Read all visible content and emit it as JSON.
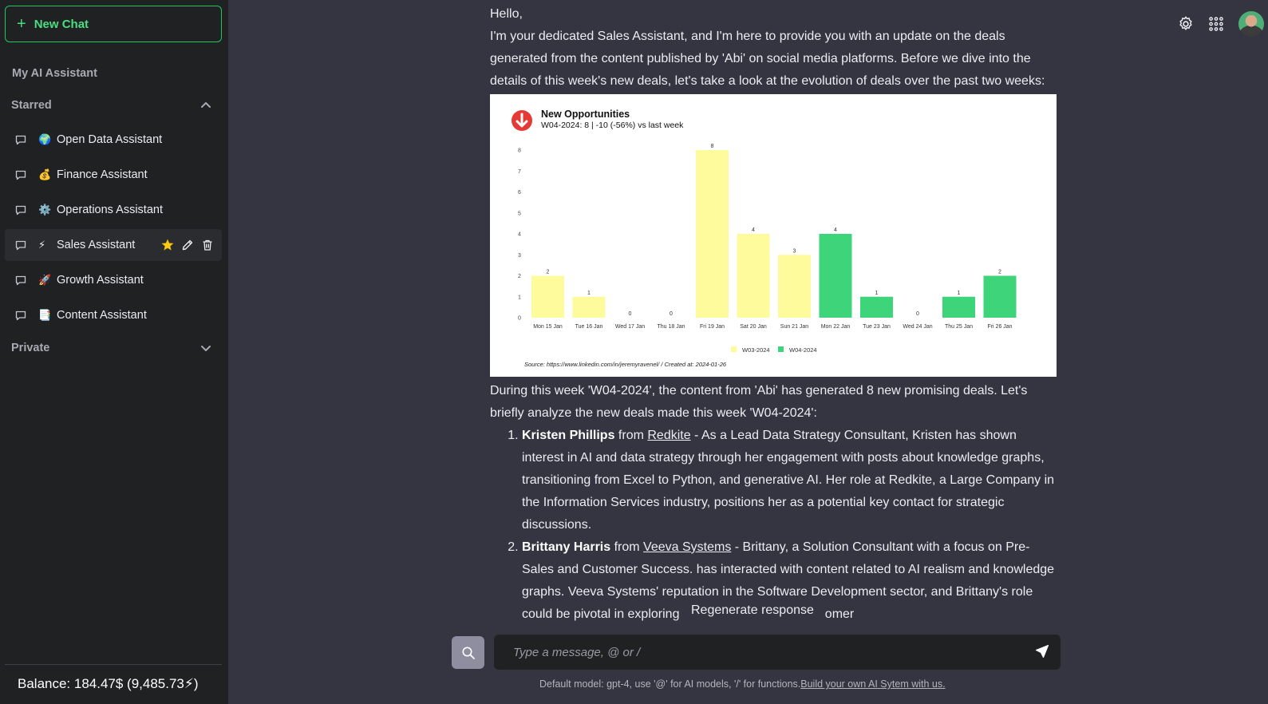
{
  "sidebar": {
    "new_chat": "New Chat",
    "my_assistant": "My AI Assistant",
    "starred": "Starred",
    "private": "Private",
    "items": [
      {
        "emoji": "🌍",
        "label": "Open Data Assistant"
      },
      {
        "emoji": "💰",
        "label": "Finance Assistant"
      },
      {
        "emoji": "⚙️",
        "label": "Operations Assistant"
      },
      {
        "emoji": "⚡",
        "label": "Sales Assistant"
      },
      {
        "emoji": "🚀",
        "label": "Growth Assistant"
      },
      {
        "emoji": "📑",
        "label": "Content Assistant"
      }
    ],
    "balance": "Balance: 184.47$ (9,485.73⚡)"
  },
  "message": {
    "greeting": "Hello,",
    "intro": "I'm your dedicated Sales Assistant, and I'm here to provide you with an update on the deals generated from the content published by 'Abi' on social media platforms. Before we dive into the details of this week's new deals, let's take a look at the evolution of deals over the past two weeks:",
    "summary": "During this week 'W04-2024', the content from 'Abi' has generated 8 new promising deals. Let's briefly analyze the new deals made this week 'W04-2024':",
    "deals": [
      {
        "name": "Kristen Phillips",
        "from": " from ",
        "company": "Redkite",
        "text": " - As a Lead Data Strategy Consultant, Kristen has shown interest in AI and data strategy through her engagement with posts about knowledge graphs, transitioning from Excel to Python, and generative AI. Her role at Redkite, a Large Company in the Information Services industry, positions her as a potential key contact for strategic discussions."
      },
      {
        "name": "Brittany Harris",
        "from": " from ",
        "company": "Veeva Systems",
        "text": " - Brittany, a Solution Consultant with a focus on Pre-Sales and Customer Success. has interacted with content related to AI realism and knowledge graphs. Veeva Systems' reputation in the Software Development sector, and Brittany's role could be pivotal in exploring how AI can enhance customer"
      }
    ]
  },
  "chart_data": {
    "type": "bar",
    "title": "New Opportunities",
    "subtitle": "W04-2024: 8 | -10 (-56%) vs last week",
    "categories": [
      "Mon 15 Jan",
      "Tue 16 Jan",
      "Wed 17 Jan",
      "Thu 18 Jan",
      "Fri 19 Jan",
      "Sat 20 Jan",
      "Sun 21 Jan",
      "Mon 22 Jan",
      "Tue 23 Jan",
      "Wed 24 Jan",
      "Thu 25 Jan",
      "Fri 26 Jan"
    ],
    "values": [
      2,
      1,
      0,
      0,
      8,
      4,
      3,
      4,
      1,
      0,
      1,
      2
    ],
    "series_of_bar": [
      "W03-2024",
      "W03-2024",
      "W03-2024",
      "W03-2024",
      "W03-2024",
      "W03-2024",
      "W03-2024",
      "W04-2024",
      "W04-2024",
      "W04-2024",
      "W04-2024",
      "W04-2024"
    ],
    "legend": [
      {
        "name": "W03-2024",
        "color": "#fefb9d"
      },
      {
        "name": "W04-2024",
        "color": "#3ed47a"
      }
    ],
    "yticks": [
      0,
      1,
      2,
      3,
      4,
      5,
      6,
      7,
      8
    ],
    "ylim": [
      0,
      8
    ],
    "source": "Source: https://www.linkedin.com/in/jeremyravenel/ / Created at: 2024-01-26",
    "legend_position": "bottom-center",
    "grid": false
  },
  "overlay": {
    "regenerate": "Regenerate response"
  },
  "composer": {
    "placeholder": "Type a message, @ or /",
    "footer_text": "Default model: gpt-4, use '@' for AI models, '/' for functions.",
    "footer_link": "Build your own AI Sytem with us."
  },
  "colors": {
    "accent": "#22c55e",
    "background": "#343541",
    "sidebar": "#202123"
  }
}
